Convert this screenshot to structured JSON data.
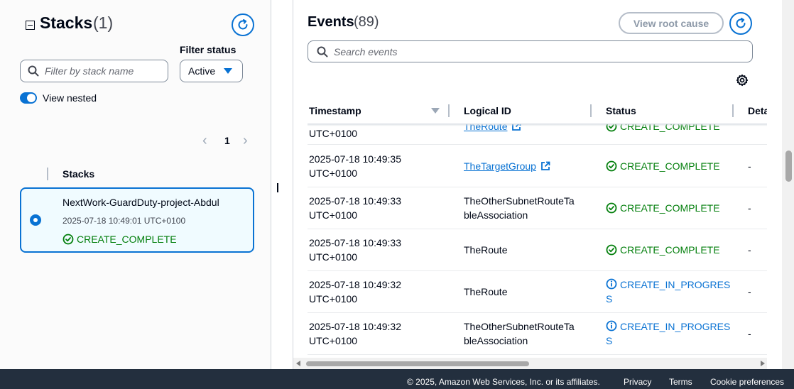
{
  "stacks_panel": {
    "title": "Stacks",
    "count": "(1)",
    "refresh_icon": "refresh-icon",
    "filter_status_label": "Filter status",
    "search_placeholder": "Filter by stack name",
    "filter_status_value": "Active",
    "view_nested_label": "View nested",
    "view_nested_on": true,
    "pagination": {
      "current_page": "1"
    },
    "column_header": "Stacks",
    "stacks": [
      {
        "name": "NextWork-GuardDuty-project-Abdul",
        "created": "2025-07-18 10:49:01 UTC+0100",
        "status": "CREATE_COMPLETE",
        "selected": true
      }
    ]
  },
  "events_panel": {
    "title": "Events",
    "count": "(89)",
    "view_root_cause_label": "View root cause",
    "search_placeholder": "Search events",
    "columns": [
      "Timestamp",
      "Logical ID",
      "Status",
      "Deta"
    ],
    "partial_row": {
      "timestamp_line2": "UTC+0100",
      "logical_id": "TheRoute",
      "status": "CREATE_COMPLETE"
    },
    "rows": [
      {
        "ts1": "2025-07-18 10:49:35",
        "ts2": "UTC+0100",
        "id1": "TheTargetGroup",
        "id2": "",
        "id_link": true,
        "status1": "CREATE_COMPLETE",
        "status2": "",
        "status_kind": "complete",
        "detail": "-"
      },
      {
        "ts1": "2025-07-18 10:49:33",
        "ts2": "UTC+0100",
        "id1": "TheOtherSubnetRouteTa",
        "id2": "bleAssociation",
        "id_link": false,
        "status1": "CREATE_COMPLETE",
        "status2": "",
        "status_kind": "complete",
        "detail": "-"
      },
      {
        "ts1": "2025-07-18 10:49:33",
        "ts2": "UTC+0100",
        "id1": "TheRoute",
        "id2": "",
        "id_link": false,
        "status1": "CREATE_COMPLETE",
        "status2": "",
        "status_kind": "complete",
        "detail": "-"
      },
      {
        "ts1": "2025-07-18 10:49:32",
        "ts2": "UTC+0100",
        "id1": "TheRoute",
        "id2": "",
        "id_link": false,
        "status1": "CREATE_IN_PROGRES",
        "status2": "S",
        "status_kind": "in-progress",
        "detail": "-"
      },
      {
        "ts1": "2025-07-18 10:49:32",
        "ts2": "UTC+0100",
        "id1": "TheOtherSubnetRouteTa",
        "id2": "bleAssociation",
        "id_link": false,
        "status1": "CREATE_IN_PROGRES",
        "status2": "S",
        "status_kind": "in-progress",
        "detail": "-"
      }
    ]
  },
  "footer": {
    "copyright": "© 2025, Amazon Web Services, Inc. or its affiliates.",
    "privacy": "Privacy",
    "terms": "Terms",
    "cookie_preferences": "Cookie preferences"
  },
  "colors": {
    "accent": "#0972d3",
    "success": "#037f0c",
    "footer_bg": "#232f3e"
  }
}
